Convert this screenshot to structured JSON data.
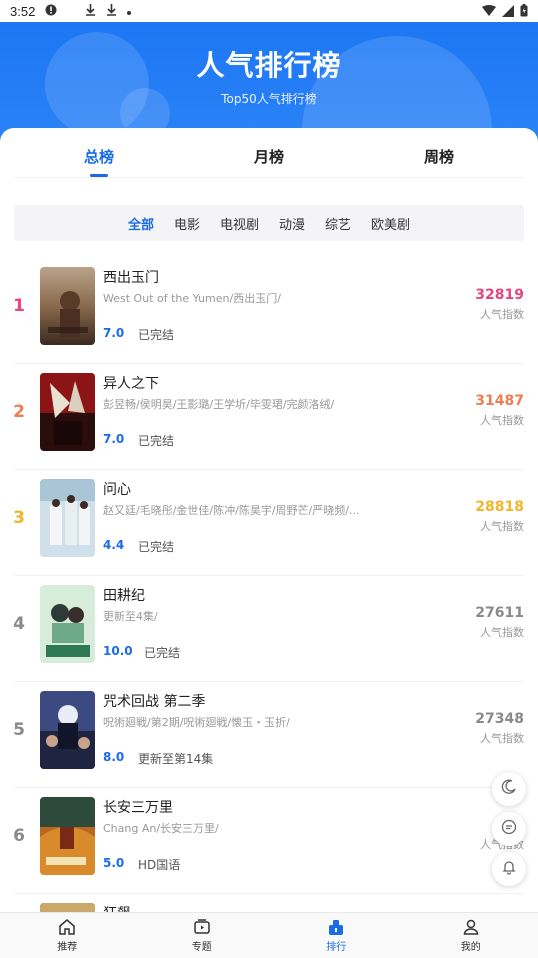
{
  "status_bar": {
    "time": "3:52"
  },
  "header": {
    "title": "人气排行榜",
    "subtitle": "Top50人气排行榜"
  },
  "tabs": [
    {
      "label": "总榜",
      "active": true
    },
    {
      "label": "月榜",
      "active": false
    },
    {
      "label": "周榜",
      "active": false
    }
  ],
  "filters": [
    {
      "label": "全部",
      "active": true
    },
    {
      "label": "电影",
      "active": false
    },
    {
      "label": "电视剧",
      "active": false
    },
    {
      "label": "动漫",
      "active": false
    },
    {
      "label": "综艺",
      "active": false
    },
    {
      "label": "欧美剧",
      "active": false
    }
  ],
  "heat_label": "人气指数",
  "items": [
    {
      "rank": "1",
      "title": "西出玉门",
      "meta": "West Out of the Yumen/西出玉门/",
      "score": "7.0",
      "status": "已完结",
      "heat": "32819",
      "rank_color": "#e8457a",
      "heat_color": "#e8457a"
    },
    {
      "rank": "2",
      "title": "异人之下",
      "meta": "彭昱畅/侯明昊/王影璐/王学圻/毕雯珺/完颜洛绒/",
      "score": "7.0",
      "status": "已完结",
      "heat": "31487",
      "rank_color": "#ef7d4f",
      "heat_color": "#ef7d4f"
    },
    {
      "rank": "3",
      "title": "问心",
      "meta": "赵又廷/毛晓彤/金世佳/陈冲/陈昊宇/周野芒/严晓频/...",
      "score": "4.4",
      "status": "已完结",
      "heat": "28818",
      "rank_color": "#f1b52a",
      "heat_color": "#f1b52a"
    },
    {
      "rank": "4",
      "title": "田耕纪",
      "meta": "更新至4集/",
      "score": "10.0",
      "status": "已完结",
      "heat": "27611",
      "rank_color": "#8a8a8a",
      "heat_color": "#8a8a8a"
    },
    {
      "rank": "5",
      "title": "咒术回战 第二季",
      "meta": "呪術廻戦/第2期/呪術廻戦/懐玉・玉折/",
      "score": "8.0",
      "status": "更新至第14集",
      "heat": "27348",
      "rank_color": "#8a8a8a",
      "heat_color": "#8a8a8a"
    },
    {
      "rank": "6",
      "title": "长安三万里",
      "meta": "Chang An/长安三万里/",
      "score": "5.0",
      "status": "HD国语",
      "heat": "2",
      "rank_color": "#8a8a8a",
      "heat_color": "#8a8a8a"
    },
    {
      "rank": "",
      "title": "狂飙",
      "meta": "",
      "score": "",
      "status": "",
      "heat": "",
      "rank_color": "#8a8a8a",
      "heat_color": "#8a8a8a"
    }
  ],
  "bottom_nav": [
    {
      "label": "推荐",
      "icon": "home-icon",
      "active": false
    },
    {
      "label": "专题",
      "icon": "play-screen-icon",
      "active": false
    },
    {
      "label": "排行",
      "icon": "ranking-icon",
      "active": true
    },
    {
      "label": "我的",
      "icon": "user-icon",
      "active": false
    }
  ],
  "colors": {
    "accent": "#1a6be6",
    "header": "#1a74f3"
  }
}
